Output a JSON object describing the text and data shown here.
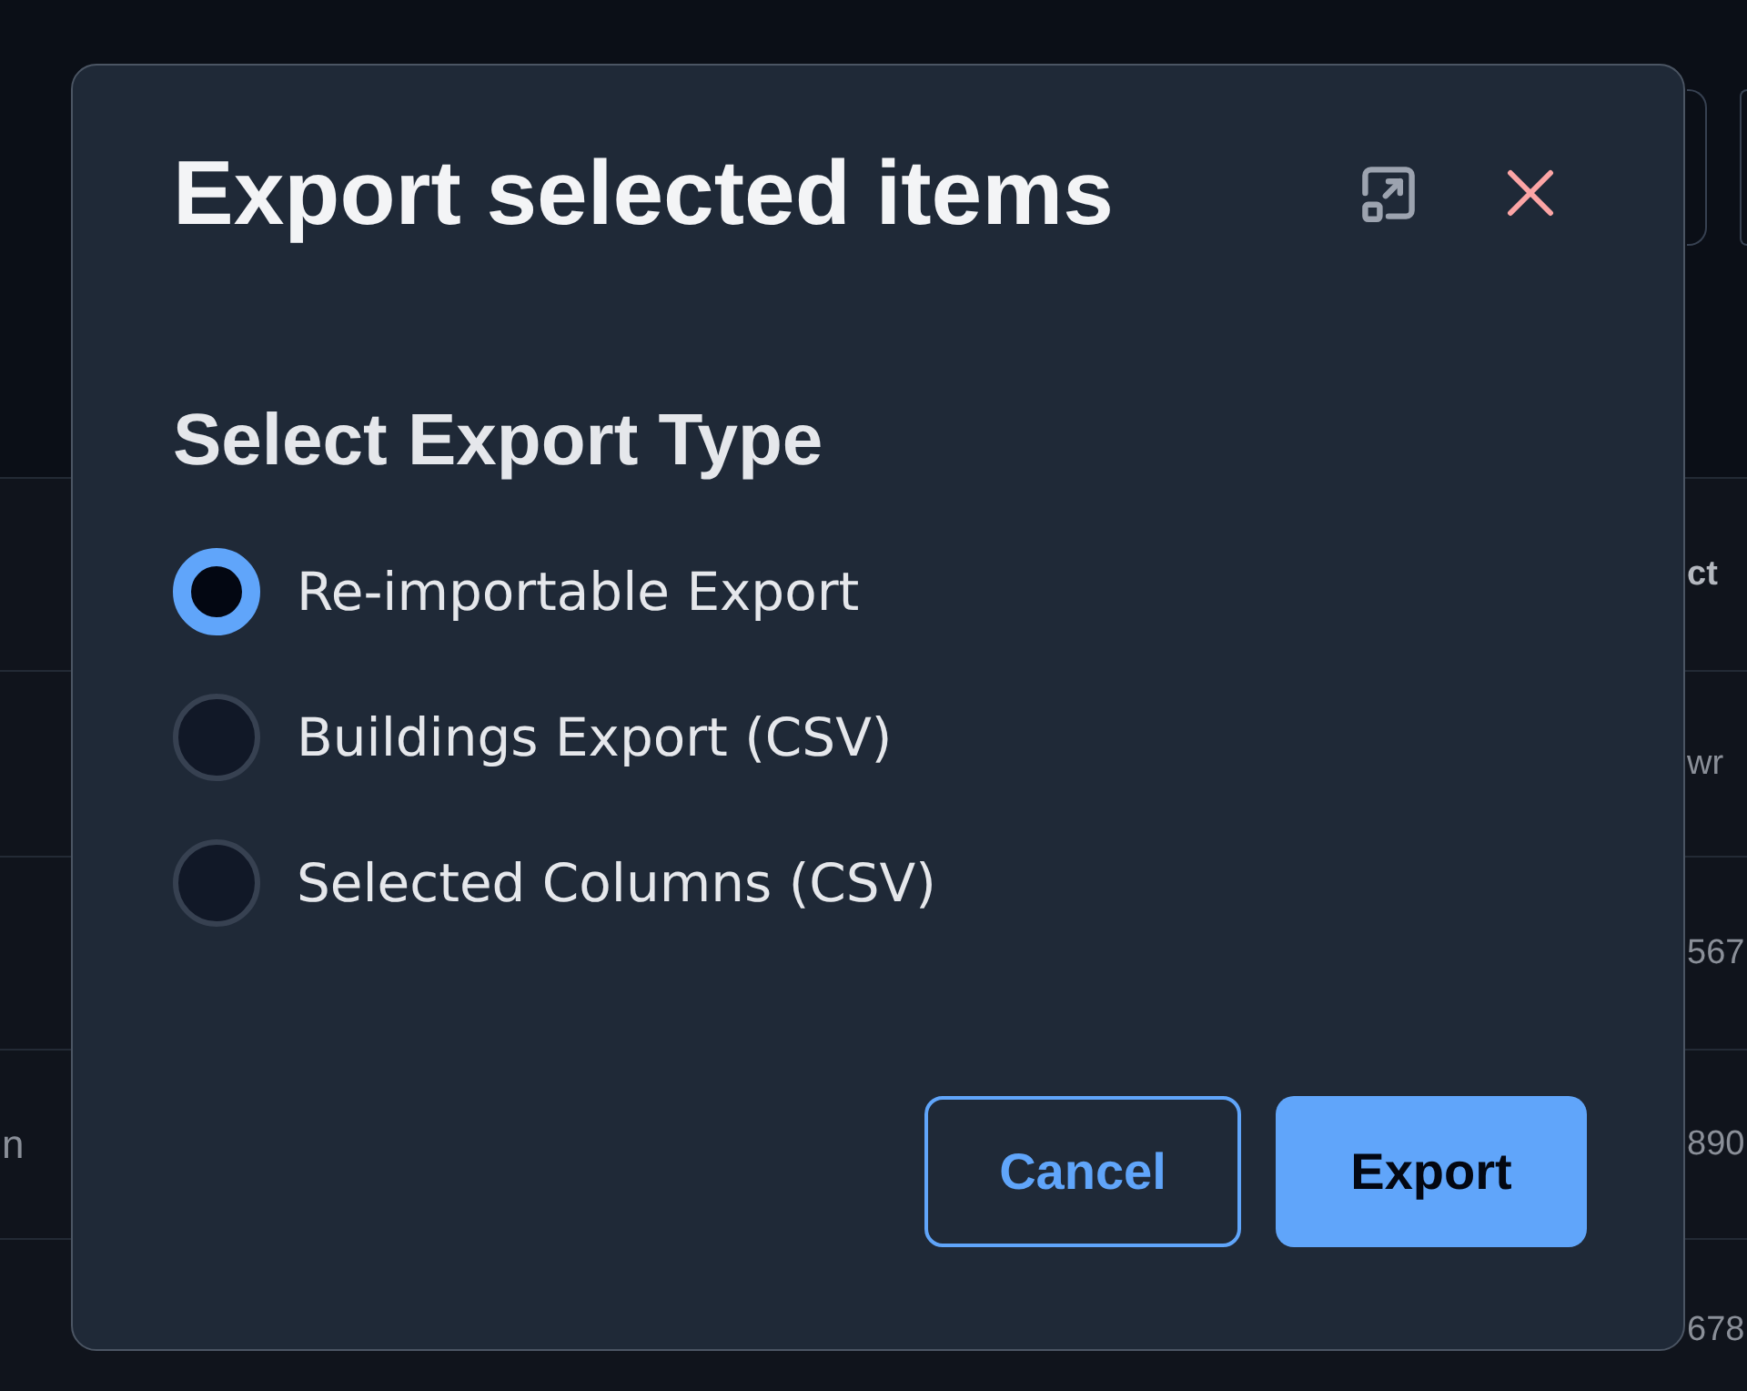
{
  "background_table": {
    "header": {
      "column_2": "ct"
    },
    "rows": [
      {
        "column_2": "wr"
      },
      {
        "column_2": "567"
      },
      {
        "column_1": "n",
        "column_2": "890"
      },
      {
        "column_2": "678"
      }
    ]
  },
  "dialog": {
    "title": "Export selected items",
    "section_title": "Select Export Type",
    "options": [
      {
        "label": "Re-importable Export",
        "selected": true
      },
      {
        "label": "Buildings Export (CSV)",
        "selected": false
      },
      {
        "label": "Selected Columns (CSV)",
        "selected": false
      }
    ],
    "buttons": [
      {
        "label": "Cancel",
        "kind": "secondary"
      },
      {
        "label": "Export",
        "kind": "primary"
      }
    ]
  }
}
